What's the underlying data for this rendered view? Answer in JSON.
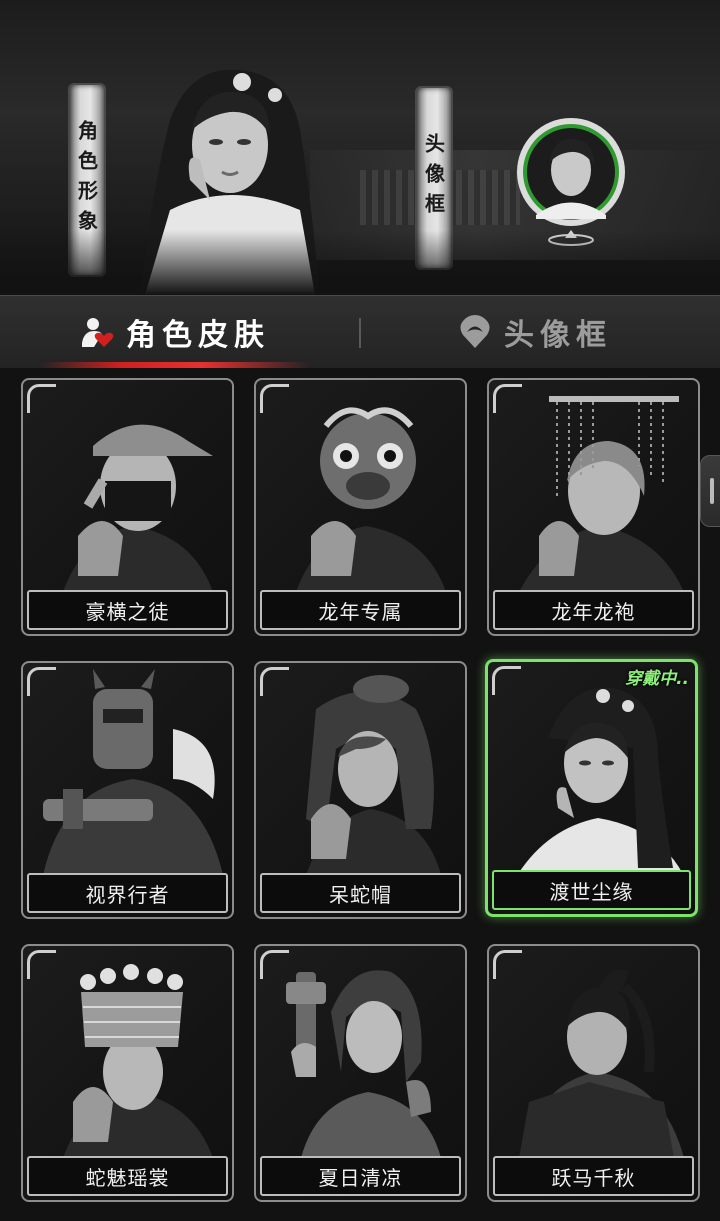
{
  "hero": {
    "left_label": "角色形象",
    "right_label": "头像框"
  },
  "tabs": [
    {
      "label": "角色皮肤",
      "icon": "user-heart-icon",
      "active": true
    },
    {
      "label": "头像框",
      "icon": "location-pin-icon",
      "active": false
    }
  ],
  "skins": [
    {
      "name": "豪横之徒",
      "icon": "masked-cap-portrait"
    },
    {
      "name": "龙年专属",
      "icon": "dragon-mask-portrait"
    },
    {
      "name": "龙年龙袍",
      "icon": "beaded-crown-portrait"
    },
    {
      "name": "视界行者",
      "icon": "robot-mask-portrait"
    },
    {
      "name": "呆蛇帽",
      "icon": "snake-hood-portrait"
    },
    {
      "name": "渡世尘缘",
      "icon": "classic-robe-portrait",
      "badge": "穿戴中.."
    },
    {
      "name": "蛇魅瑶裳",
      "icon": "silver-headdress-portrait"
    },
    {
      "name": "夏日清凉",
      "icon": "summer-gun-portrait"
    },
    {
      "name": "跃马千秋",
      "icon": "ponytail-warrior-portrait"
    }
  ],
  "colors": {
    "accent_red": "#d02020",
    "equipped_green": "#7de36a"
  }
}
